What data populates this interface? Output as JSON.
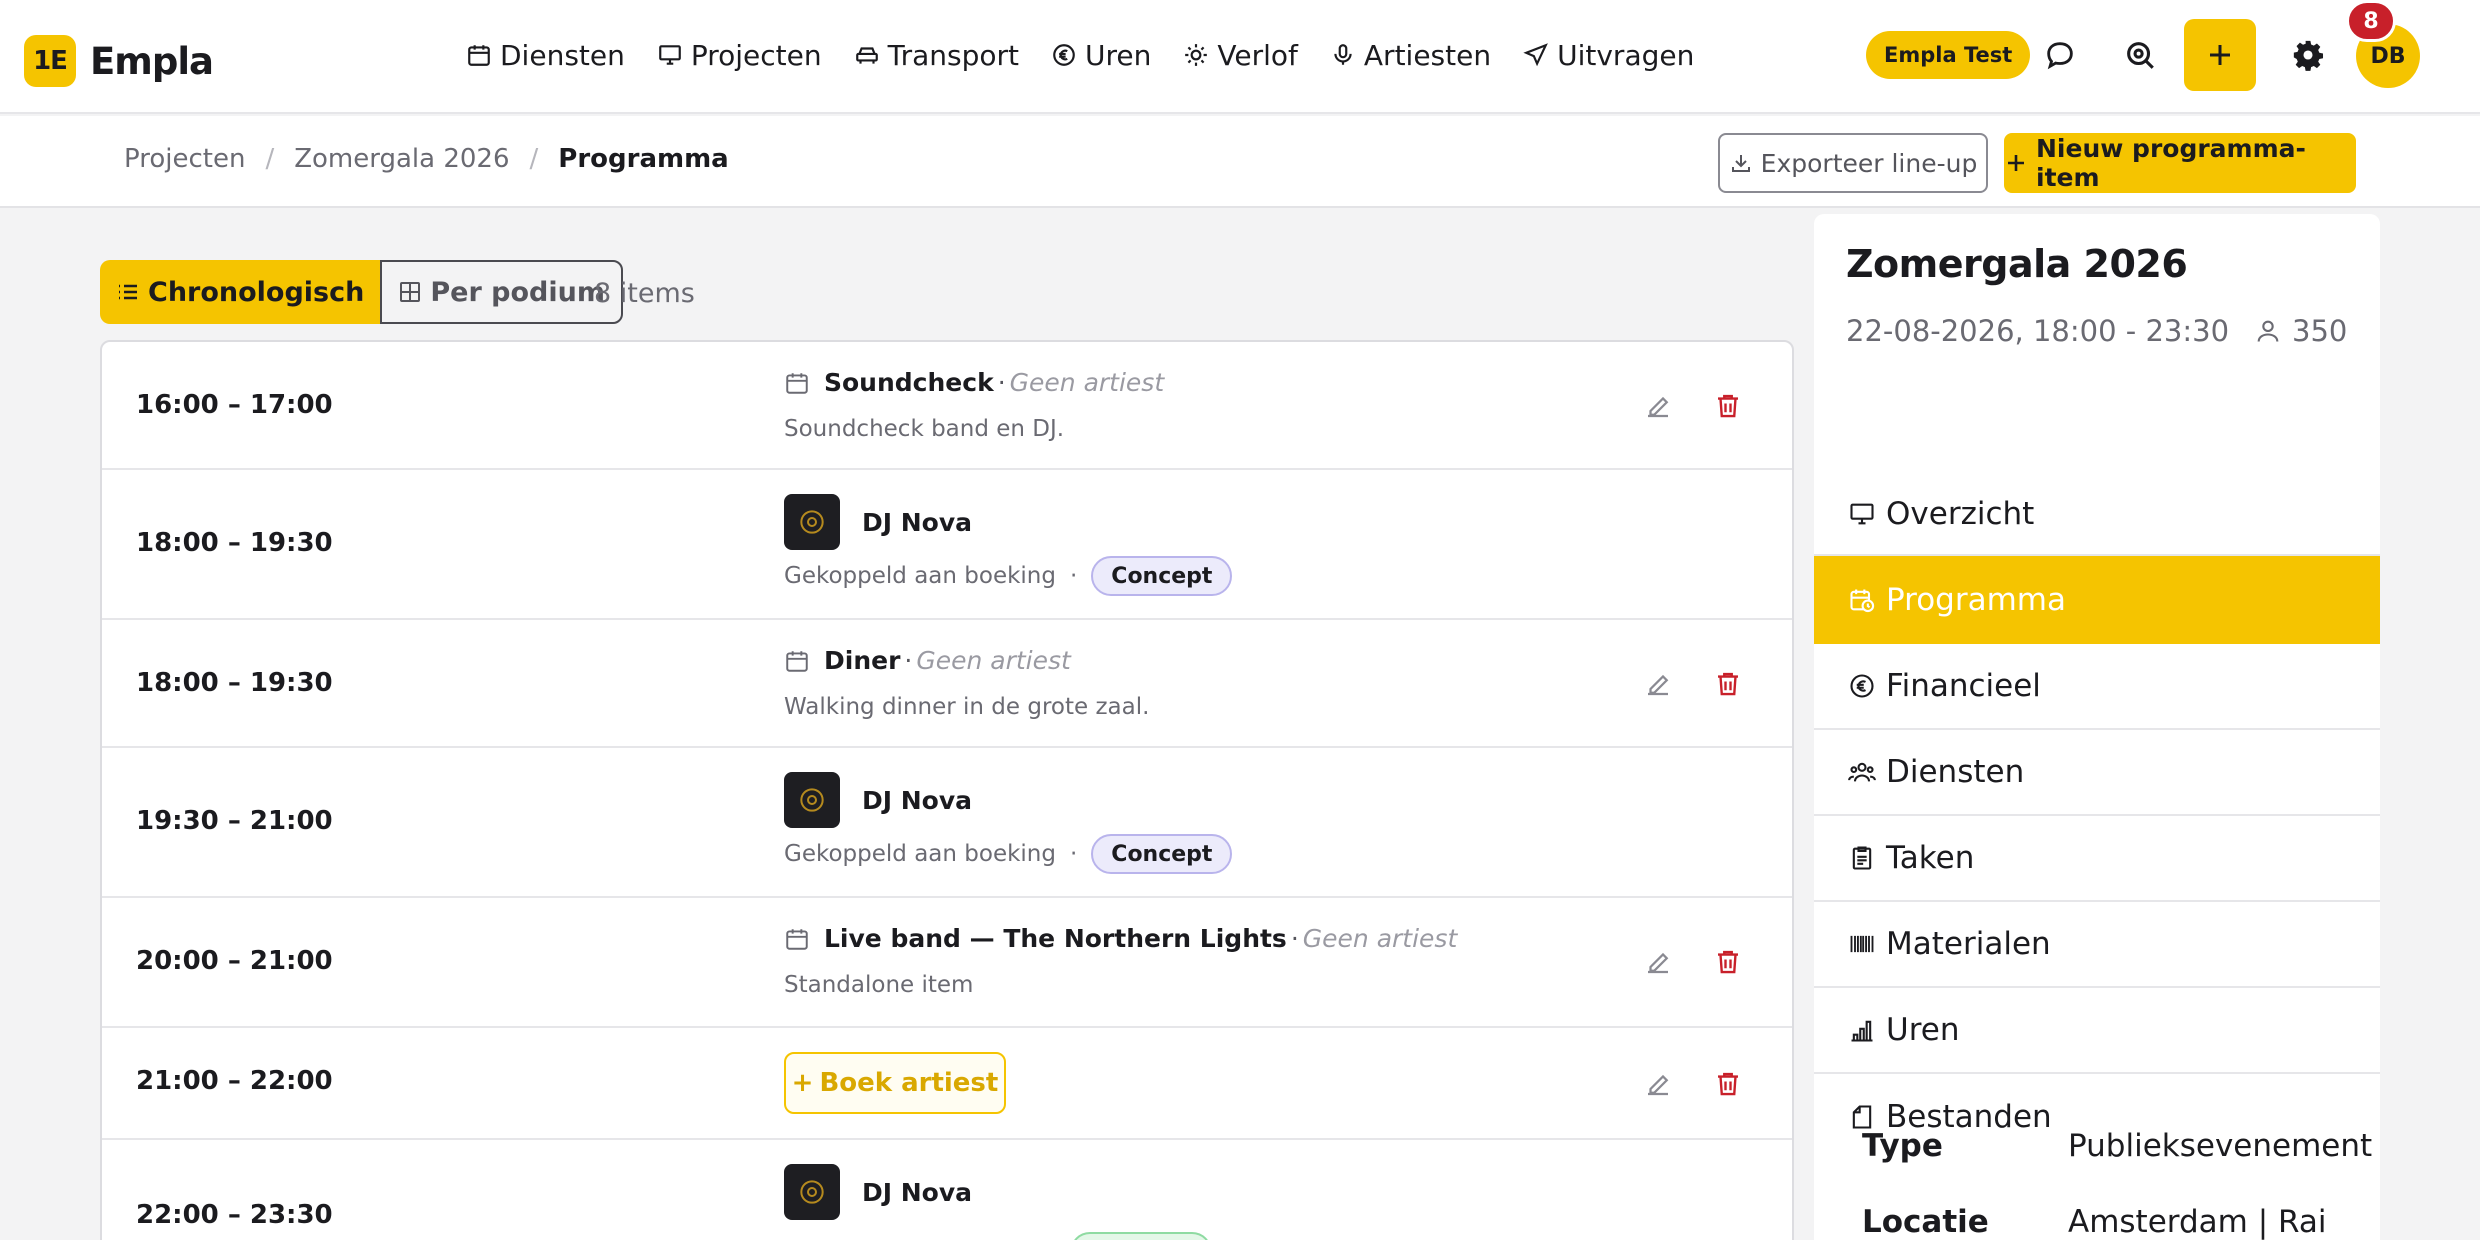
{
  "app": {
    "logo_mark": "1E",
    "name": "Empla"
  },
  "nav": {
    "items": [
      {
        "label": "Diensten",
        "icon": "calendar-icon"
      },
      {
        "label": "Projecten",
        "icon": "monitor-icon"
      },
      {
        "label": "Transport",
        "icon": "car-icon"
      },
      {
        "label": "Uren",
        "icon": "euro-icon"
      },
      {
        "label": "Verlof",
        "icon": "sun-icon"
      },
      {
        "label": "Artiesten",
        "icon": "microphone-icon"
      },
      {
        "label": "Uitvragen",
        "icon": "send-icon"
      }
    ],
    "environment": "Empla Test",
    "user_initials": "DB",
    "notification_count": "8"
  },
  "breadcrumb": {
    "items": [
      "Projecten",
      "Zomergala 2026"
    ],
    "current": "Programma"
  },
  "actions": {
    "export": "Exporteer line-up",
    "new_item": "Nieuw programma-item"
  },
  "view": {
    "chronological": "Chronologisch",
    "per_stage": "Per podium",
    "count": "8 items"
  },
  "program": {
    "items": [
      {
        "time": "16:00 – 17:00",
        "title": "Soundcheck",
        "artist_note": "Geen artiest",
        "description": "Soundcheck band en DJ."
      },
      {
        "time": "18:00 – 19:30",
        "artist": "DJ Nova",
        "link_text": "Gekoppeld aan boeking",
        "status": "Concept"
      },
      {
        "time": "18:00 – 19:30",
        "title": "Diner",
        "artist_note": "Geen artiest",
        "description": "Walking dinner in de grote zaal."
      },
      {
        "time": "19:30 – 21:00",
        "artist": "DJ Nova",
        "link_text": "Gekoppeld aan boeking",
        "status": "Concept"
      },
      {
        "time": "20:00 – 21:00",
        "title": "Live band — The Northern Lights",
        "artist_note": "Geen artiest",
        "description": "Standalone item"
      },
      {
        "time": "21:00 – 22:00",
        "book_label": "Boek artiest"
      },
      {
        "time": "22:00 – 23:30",
        "artist": "DJ Nova"
      }
    ],
    "separator": "·"
  },
  "project": {
    "title": "Zomergala 2026",
    "date": "22-08-2026, 18:00 - 23:30",
    "capacity": "350",
    "menu": [
      {
        "label": "Overzicht",
        "icon": "monitor-icon"
      },
      {
        "label": "Programma",
        "icon": "calendar-clock-icon"
      },
      {
        "label": "Financieel",
        "icon": "euro-icon"
      },
      {
        "label": "Diensten",
        "icon": "users-icon"
      },
      {
        "label": "Taken",
        "icon": "clipboard-icon"
      },
      {
        "label": "Materialen",
        "icon": "barcode-icon"
      },
      {
        "label": "Uren",
        "icon": "bar-chart-icon"
      },
      {
        "label": "Bestanden",
        "icon": "file-icon"
      }
    ],
    "active_menu": "Programma",
    "properties": [
      {
        "key": "Type",
        "value": "Publieksevenement"
      },
      {
        "key": "Locatie",
        "value": "Amsterdam | Rai"
      }
    ]
  },
  "colors": {
    "accent": "#f5c400",
    "danger": "#c8202a",
    "concept": "#ecebfb",
    "confirmed": "#e4f7e8"
  }
}
